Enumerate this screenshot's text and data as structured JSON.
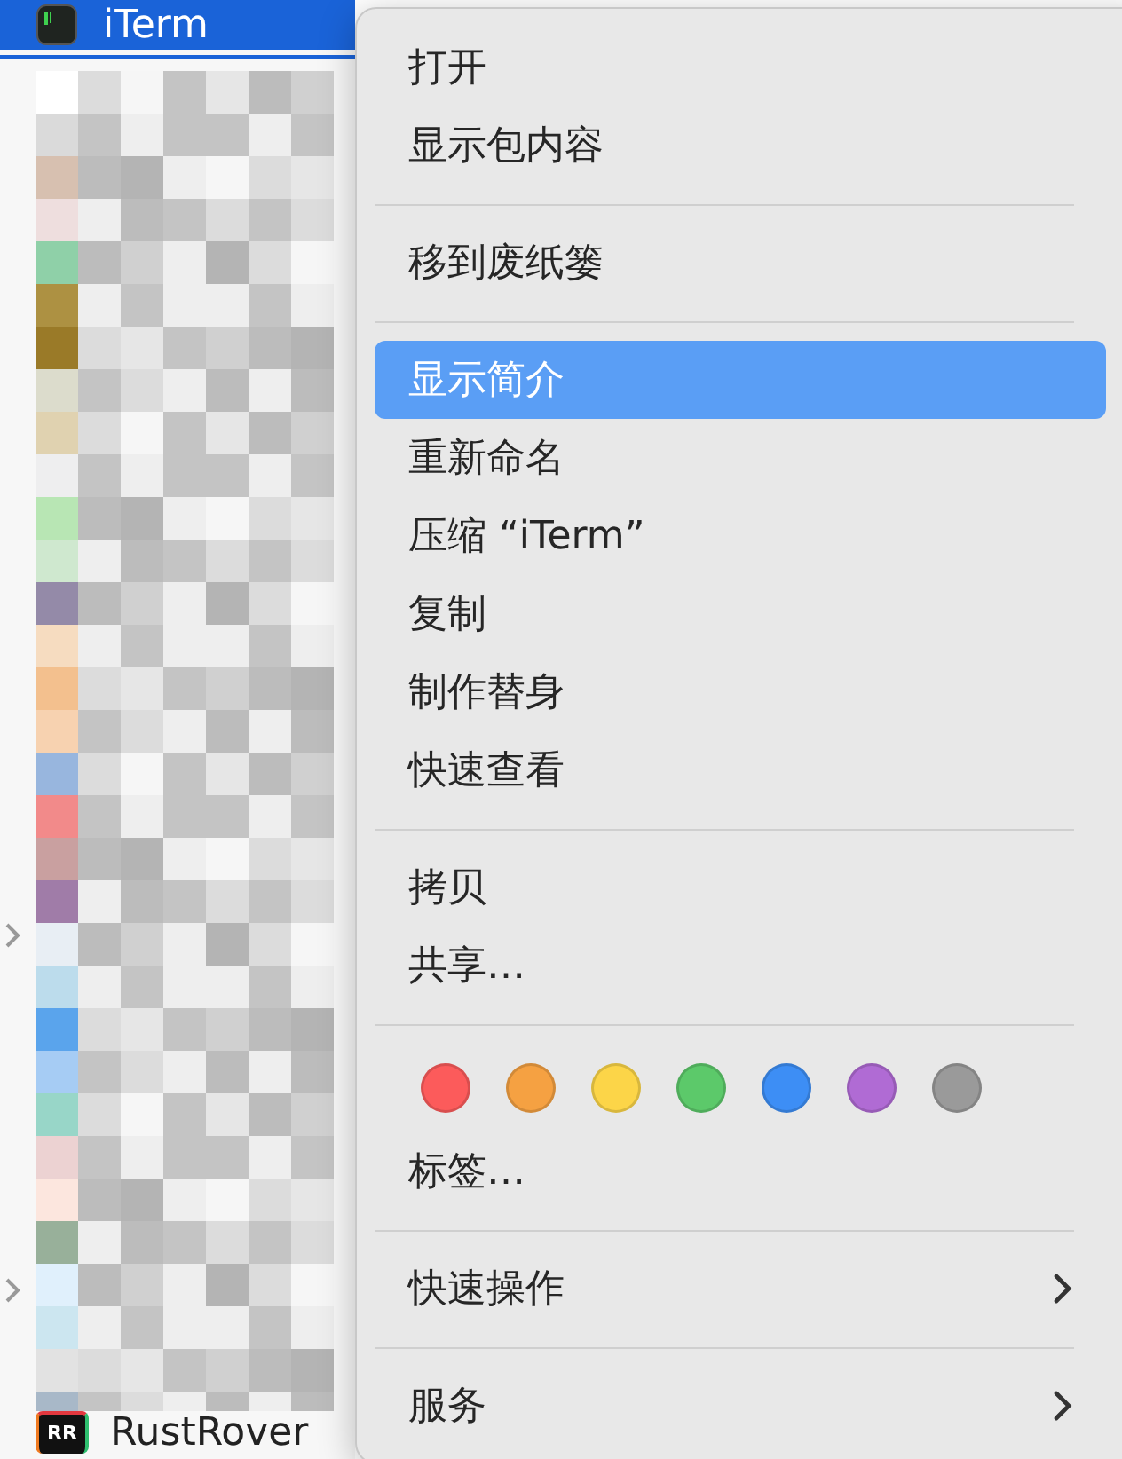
{
  "file_list": {
    "selected_item": {
      "name": "iTerm",
      "selected": true
    },
    "disclosure_rows": [
      {
        "expanded": false
      },
      {
        "expanded": false
      }
    ],
    "bottom_item": {
      "name": "RustRover",
      "icon_label": "RR",
      "selected": false
    }
  },
  "context_menu": {
    "items": [
      {
        "kind": "item",
        "label": "打开",
        "selected": false,
        "submenu": false
      },
      {
        "kind": "item",
        "label": "显示包内容",
        "selected": false,
        "submenu": false
      },
      {
        "kind": "separator"
      },
      {
        "kind": "item",
        "label": "移到废纸篓",
        "selected": false,
        "submenu": false
      },
      {
        "kind": "separator"
      },
      {
        "kind": "item",
        "label": "显示简介",
        "selected": true,
        "submenu": false
      },
      {
        "kind": "item",
        "label": "重新命名",
        "selected": false,
        "submenu": false
      },
      {
        "kind": "item",
        "label": "压缩 “iTerm”",
        "selected": false,
        "submenu": false
      },
      {
        "kind": "item",
        "label": "复制",
        "selected": false,
        "submenu": false
      },
      {
        "kind": "item",
        "label": "制作替身",
        "selected": false,
        "submenu": false
      },
      {
        "kind": "item",
        "label": "快速查看",
        "selected": false,
        "submenu": false
      },
      {
        "kind": "separator"
      },
      {
        "kind": "item",
        "label": "拷贝",
        "selected": false,
        "submenu": false
      },
      {
        "kind": "item",
        "label": "共享…",
        "selected": false,
        "submenu": false
      },
      {
        "kind": "separator"
      },
      {
        "kind": "tags",
        "colors": [
          {
            "color": "#fc5b5b"
          },
          {
            "color": "#f5a142"
          },
          {
            "color": "#fcd548"
          },
          {
            "color": "#5cc96a"
          },
          {
            "color": "#3d8ef5"
          },
          {
            "color": "#b06bd4"
          },
          {
            "color": "#9a9a9a"
          }
        ]
      },
      {
        "kind": "item",
        "label": "标签…",
        "selected": false,
        "submenu": false
      },
      {
        "kind": "separator"
      },
      {
        "kind": "item",
        "label": "快速操作",
        "selected": false,
        "submenu": true
      },
      {
        "kind": "separator"
      },
      {
        "kind": "item",
        "label": "服务",
        "selected": false,
        "submenu": true
      }
    ]
  }
}
